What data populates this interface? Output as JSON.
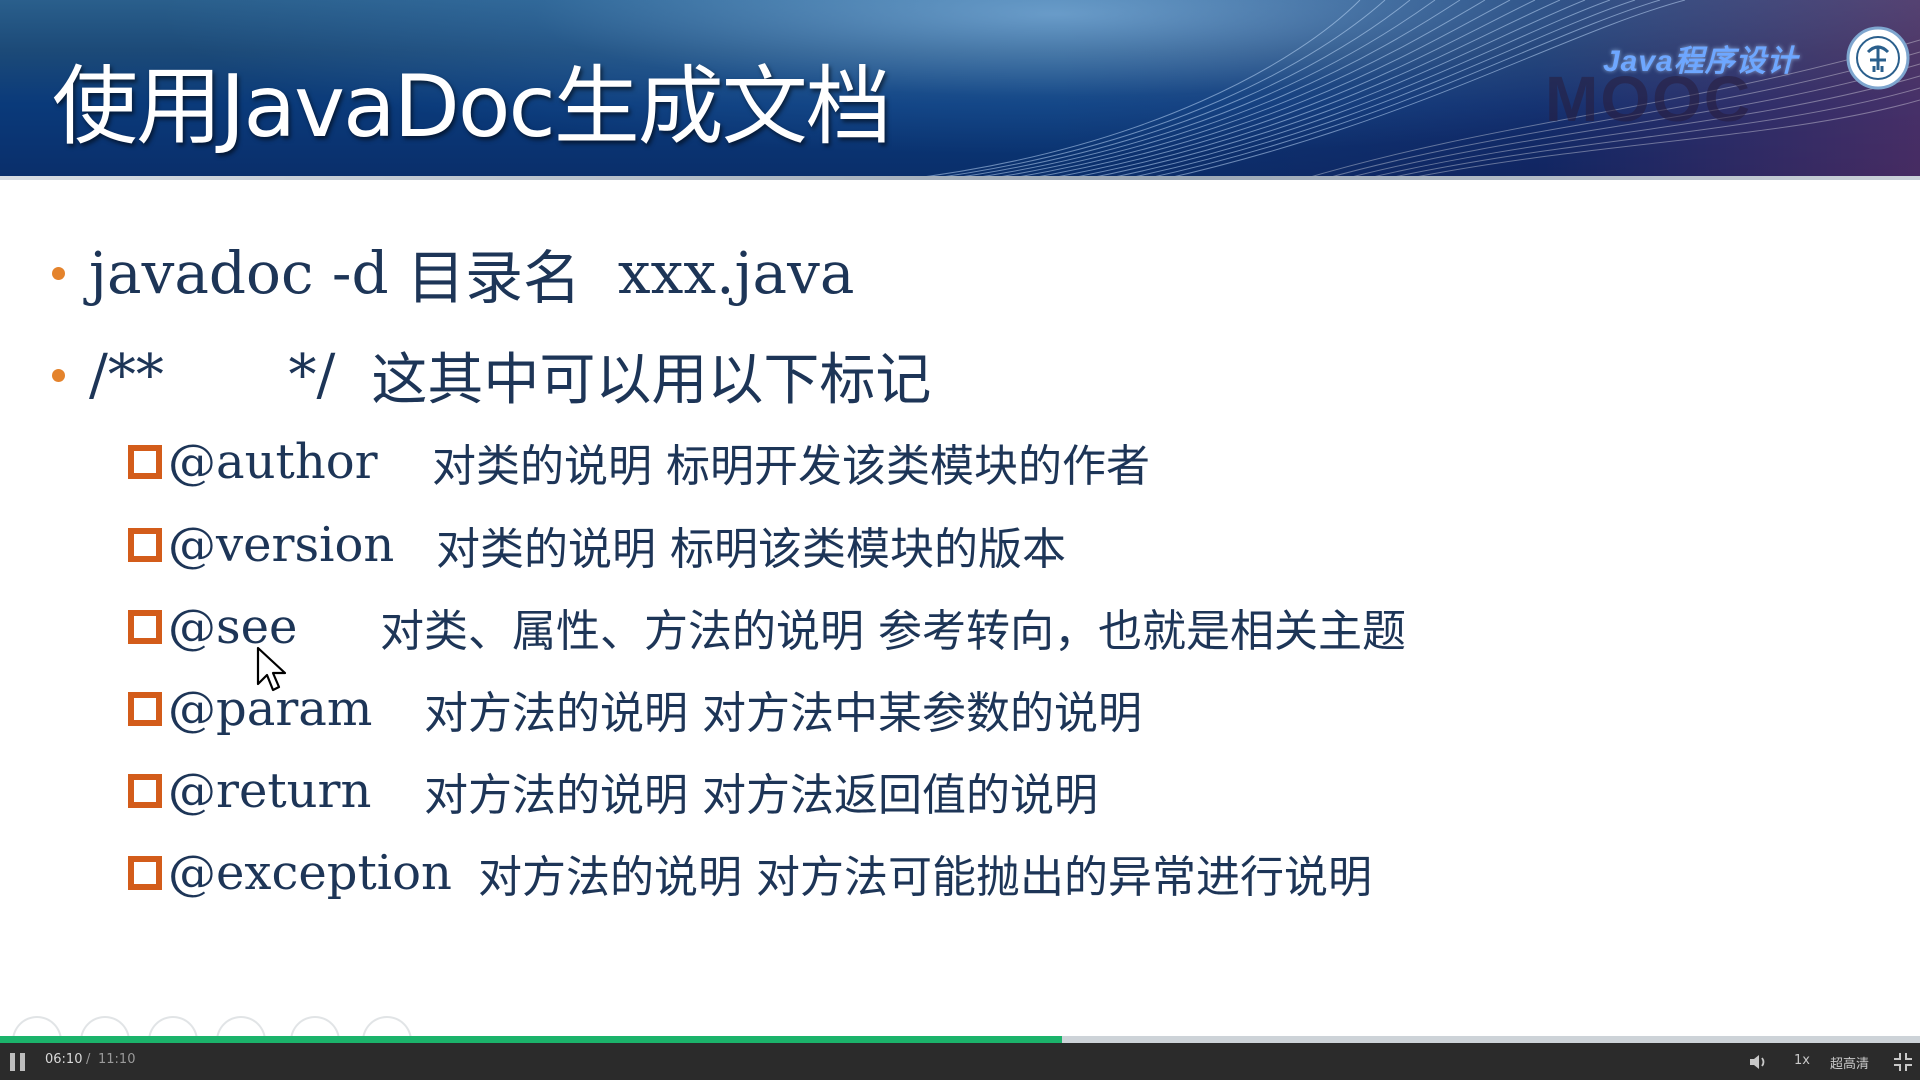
{
  "slide": {
    "title": "使用JavaDoc生成文档",
    "brand": "Java程序设计",
    "watermark": "MOOC",
    "bullets": [
      {
        "code": "javadoc -d ",
        "text": "目录名",
        "tail": "  xxx.java"
      },
      {
        "code": "/**       */",
        "text": "这其中可以用以下标记",
        "tail": ""
      }
    ],
    "tags": [
      {
        "tag": "@author",
        "desc": "对类的说明 标明开发该类模块的作者"
      },
      {
        "tag": "@version",
        "desc": "对类的说明 标明该类模块的版本"
      },
      {
        "tag": "@see",
        "desc": "对类、属性、方法的说明 参考转向，也就是相关主题"
      },
      {
        "tag": "@param",
        "desc": "对方法的说明 对方法中某参数的说明"
      },
      {
        "tag": "@return",
        "desc": "对方法的说明 对方法返回值的说明"
      },
      {
        "tag": "@exception",
        "desc": "对方法的说明 对方法可能抛出的异常进行说明"
      }
    ]
  },
  "player": {
    "current_time": "06:10",
    "separator": "/",
    "duration": "11:10",
    "progress_fraction": 0.553,
    "speed": "1x",
    "quality": "超高清",
    "icons": [
      "pause-icon",
      "volume-icon",
      "fullscreen-exit-icon"
    ]
  },
  "colors": {
    "bullet": "#e4832c",
    "box": "#d35c1a",
    "text": "#1d3557",
    "progress": "#1bb36b",
    "control_bar": "#2b2b2b"
  }
}
